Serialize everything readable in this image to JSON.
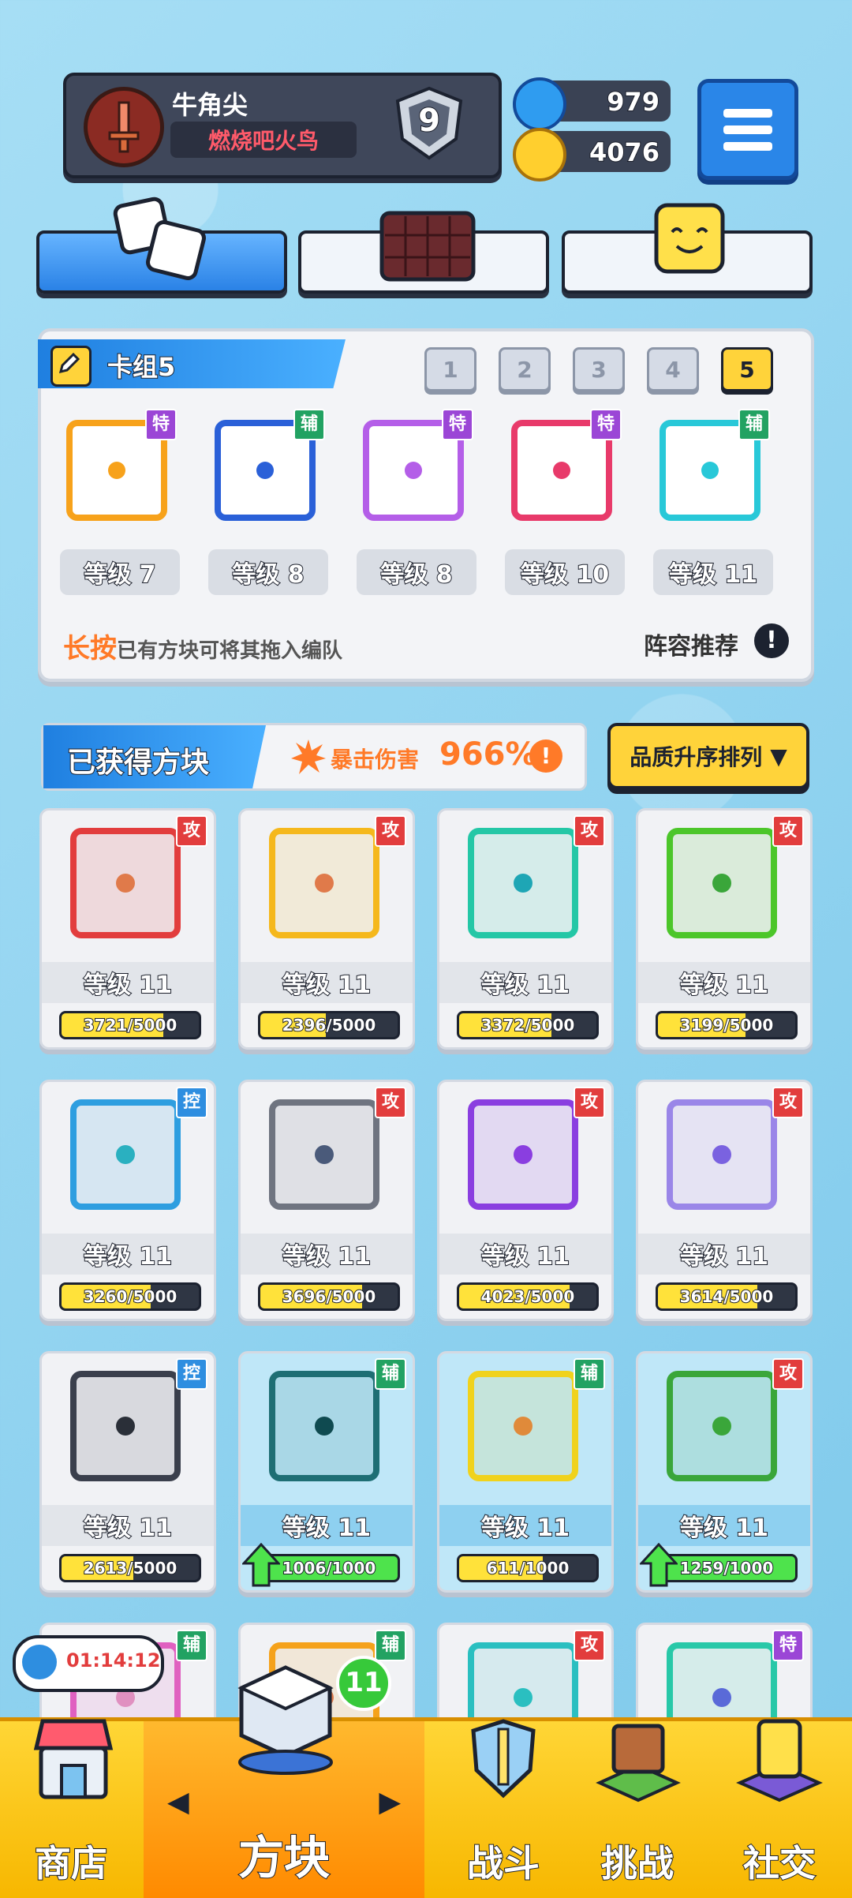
{
  "player": {
    "name": "牛角尖",
    "title": "燃烧吧火鸟",
    "rank": "9"
  },
  "currency": {
    "gems": "979",
    "coins": "4076"
  },
  "deck": {
    "label": "卡组5",
    "tabs": [
      "1",
      "2",
      "3",
      "4",
      "5"
    ],
    "active_tab": "5",
    "cards": [
      {
        "level": "等级 7",
        "tag": "特",
        "tag_type": "spc",
        "color": "#f7a21b"
      },
      {
        "level": "等级 8",
        "tag": "辅",
        "tag_type": "sup",
        "color": "#2a60d8"
      },
      {
        "level": "等级 8",
        "tag": "特",
        "tag_type": "spc",
        "color": "#b45ee8"
      },
      {
        "level": "等级 10",
        "tag": "特",
        "tag_type": "spc",
        "color": "#e83a6a"
      },
      {
        "level": "等级 11",
        "tag": "辅",
        "tag_type": "sup",
        "color": "#28c8d8"
      }
    ],
    "hint_highlight": "长按",
    "hint_rest": "已有方块可将其拖入编队",
    "lineup_recommend": "阵容推荐",
    "lineup_icon": "!"
  },
  "owned": {
    "label": "已获得方块",
    "crit_label": "暴击伤害",
    "crit_value": "966%",
    "crit_info": "!",
    "sort_label": "品质升序排列",
    "sort_arrow": "▼"
  },
  "cards": [
    {
      "level": "等级 11",
      "progress": "3721/5000",
      "pct": 0.744,
      "tag": "攻",
      "tag_type": "atk",
      "color": "#e23d3d",
      "dot": "#e07a4a"
    },
    {
      "level": "等级 11",
      "progress": "2396/5000",
      "pct": 0.479,
      "tag": "攻",
      "tag_type": "atk",
      "color": "#f5b81c",
      "dot": "#e07a4a"
    },
    {
      "level": "等级 11",
      "progress": "3372/5000",
      "pct": 0.674,
      "tag": "攻",
      "tag_type": "atk",
      "color": "#24c7a6",
      "dot": "#1ea6b5"
    },
    {
      "level": "等级 11",
      "progress": "3199/5000",
      "pct": 0.64,
      "tag": "攻",
      "tag_type": "atk",
      "color": "#4cc62a",
      "dot": "#3aa63a"
    },
    {
      "level": "等级 11",
      "progress": "3260/5000",
      "pct": 0.652,
      "tag": "控",
      "tag_type": "ctl",
      "color": "#2e9ee0",
      "dot": "#2ab0c0"
    },
    {
      "level": "等级 11",
      "progress": "3696/5000",
      "pct": 0.739,
      "tag": "攻",
      "tag_type": "atk",
      "color": "#6f7480",
      "dot": "#4a5a7a"
    },
    {
      "level": "等级 11",
      "progress": "4023/5000",
      "pct": 0.805,
      "tag": "攻",
      "tag_type": "atk",
      "color": "#8a3ee0",
      "dot": "#8a3ee0"
    },
    {
      "level": "等级 11",
      "progress": "3614/5000",
      "pct": 0.723,
      "tag": "攻",
      "tag_type": "atk",
      "color": "#9a86e8",
      "dot": "#7a62e0"
    },
    {
      "level": "等级 11",
      "progress": "2613/5000",
      "pct": 0.523,
      "tag": "控",
      "tag_type": "ctl",
      "color": "#3a3f4c",
      "dot": "#2a2f38"
    },
    {
      "level": "等级 11",
      "progress": "1006/1000",
      "pct": 1.0,
      "tag": "辅",
      "tag_type": "sup",
      "color": "#1e6e74",
      "dot": "#0f4a50",
      "green": true,
      "selected": true,
      "upgrade": true
    },
    {
      "level": "等级 11",
      "progress": "611/1000",
      "pct": 0.611,
      "tag": "辅",
      "tag_type": "sup",
      "color": "#f0d21c",
      "dot": "#e08a3a",
      "selected": true
    },
    {
      "level": "等级 11",
      "progress": "1259/1000",
      "pct": 1.0,
      "tag": "攻",
      "tag_type": "atk",
      "color": "#3aa63a",
      "dot": "#3aa63a",
      "green": true,
      "selected": true,
      "upgrade": true
    },
    {
      "tag": "辅",
      "tag_type": "sup",
      "color": "#e060c0",
      "dot": "#e090c0"
    },
    {
      "tag": "辅",
      "tag_type": "sup",
      "color": "#f5a21b",
      "dot": "#e07a4a"
    },
    {
      "tag": "攻",
      "tag_type": "atk",
      "color": "#2abfc0",
      "dot": "#2abfc0"
    },
    {
      "tag": "特",
      "tag_type": "spc",
      "color": "#28c8a8",
      "dot": "#5a6ad8"
    }
  ],
  "timer": "01:14:12",
  "blocks_badge": "11",
  "nav": {
    "shop": "商店",
    "blocks": "方块",
    "battle": "战斗",
    "challenge": "挑战",
    "social": "社交",
    "prev_arrow": "◀",
    "next_arrow": "▶"
  }
}
